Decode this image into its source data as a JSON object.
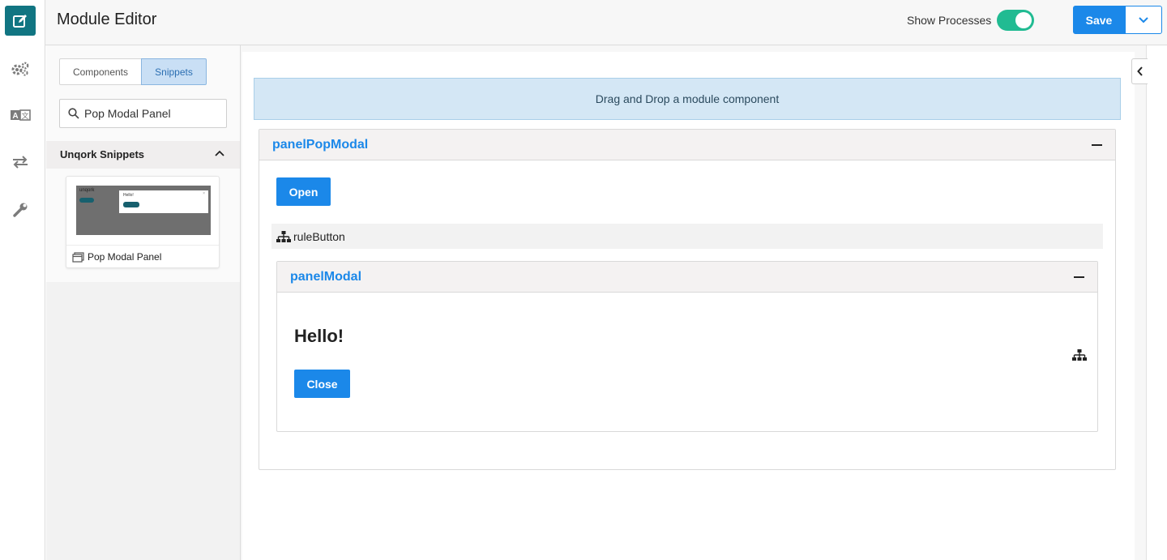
{
  "header": {
    "title": "Module Editor",
    "show_processes_label": "Show Processes",
    "show_processes_on": true,
    "save_label": "Save"
  },
  "rail": {
    "icons": [
      "edit-icon",
      "gears-icon",
      "translate-icon",
      "transfer-arrows-icon",
      "wrench-icon"
    ],
    "active": "edit-icon",
    "accent": "#117582"
  },
  "sidebar": {
    "tabs": [
      {
        "label": "Components",
        "active": false
      },
      {
        "label": "Snippets",
        "active": true
      }
    ],
    "search": {
      "value": "Pop Modal Panel"
    },
    "section_title": "Unqork Snippets",
    "snippet": {
      "label": "Pop Modal Panel",
      "thumb_brand": "unqork",
      "thumb_hello": "Hello!",
      "thumb_close": "×"
    }
  },
  "canvas": {
    "dropzone_text": "Drag and Drop a module component",
    "panel_pop": {
      "title": "panelPopModal"
    },
    "open_label": "Open",
    "rule_label": "ruleButton",
    "panel_modal": {
      "title": "panelModal"
    },
    "hello_text": "Hello!",
    "close_label": "Close"
  },
  "colors": {
    "primary": "#1b88e9",
    "toggle_on": "#21bb92",
    "dropzone_bg": "#d4e7f5"
  }
}
